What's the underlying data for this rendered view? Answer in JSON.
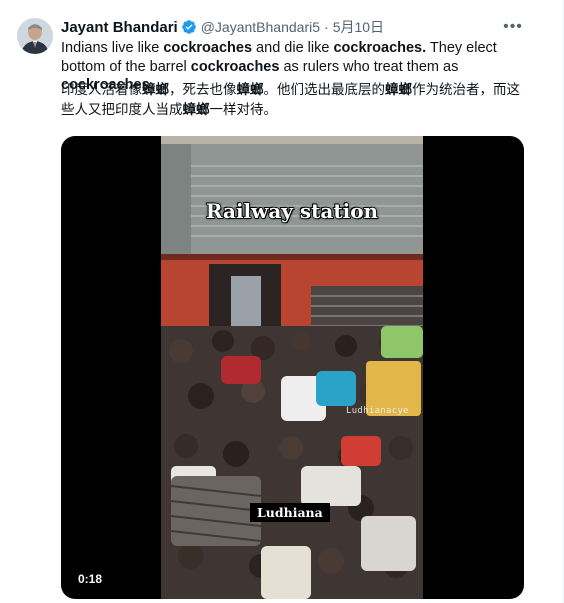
{
  "author": {
    "name": "Jayant Bhandari",
    "handle": "@JayantBhandari5",
    "separator": "·",
    "date": "5月10日",
    "verified_color": "#1d9bf0"
  },
  "tweet": {
    "en_1": "Indians live like ",
    "en_2": "cockroaches",
    "en_3": " and die like ",
    "en_4": "cockroaches.",
    "en_5": " They elect bottom of the barrel ",
    "en_6": "cockroaches",
    "en_7": " as rulers who treat them as ",
    "en_8": "cockroaches.",
    "zh_1": "印度人活着像",
    "zh_2": "蟑螂",
    "zh_3": "，死去也像",
    "zh_4": "蟑螂",
    "zh_5": "。他们选出最底层的",
    "zh_6": "蟑螂",
    "zh_7": "作为统治者，而这些人又把印度人当成",
    "zh_8": "蟑螂",
    "zh_9": "一样对待。"
  },
  "video": {
    "overlay_title": "Railway station",
    "watermark": "Ludhianacye",
    "city_label": "Ludhiana",
    "timestamp": "0:18"
  },
  "icons": {
    "more": "more-horizontal-icon",
    "verified": "verified-badge-icon"
  }
}
